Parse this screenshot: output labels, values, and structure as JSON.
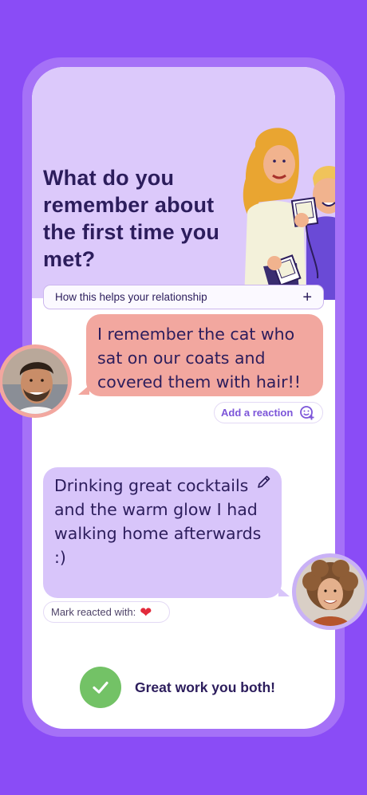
{
  "prompt": {
    "question": "What do you remember about the first time you met?",
    "helps_label": "How this helps your relationship"
  },
  "messages": [
    {
      "author": "partner",
      "text": "I remember the cat who sat on our coats and covered them with hair!!",
      "action_label": "Add a reaction"
    },
    {
      "author": "self",
      "text": "Drinking great cocktails and the warm glow I had walking home afterwards :)",
      "reaction_label": "Mark reacted with:",
      "reaction_icon": "heart-icon"
    }
  ],
  "footer": {
    "text": "Great work you both!"
  },
  "colors": {
    "background": "#8a4cf6",
    "header": "#dcc9fb",
    "partner_bubble": "#f2a79f",
    "self_bubble": "#d8c5fa",
    "success": "#73c266",
    "text": "#2c1d5c"
  }
}
